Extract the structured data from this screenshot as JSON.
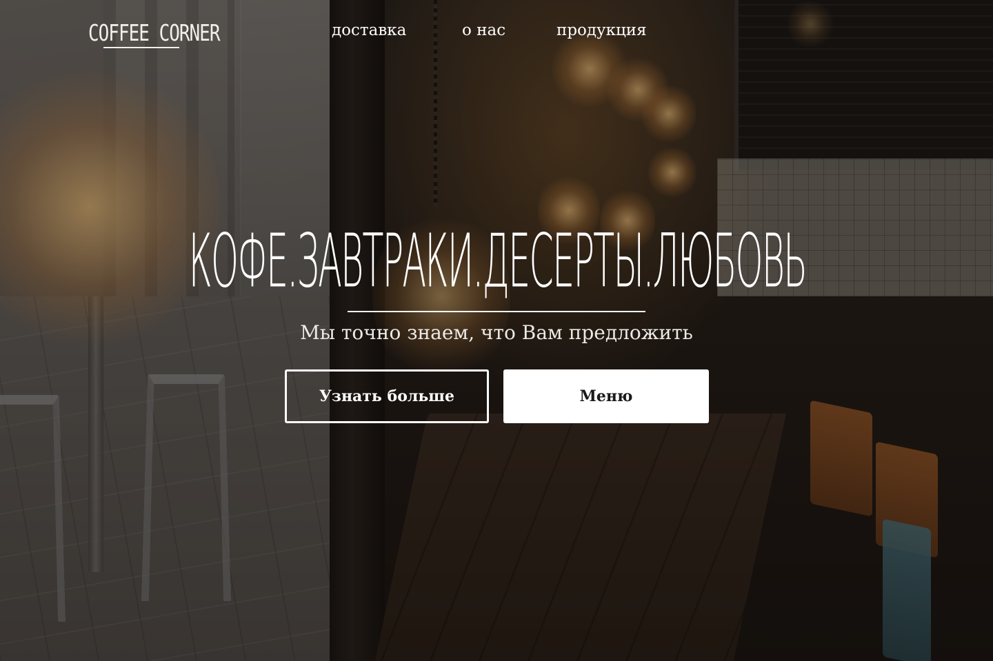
{
  "header": {
    "logo": "COFFEE CORNER",
    "nav": [
      {
        "label": "доставка"
      },
      {
        "label": "о нас"
      },
      {
        "label": "продукция"
      }
    ]
  },
  "hero": {
    "title": "КОФЕ.ЗАВТРАКИ.ДЕСЕРТЫ.ЛЮБОВЬ",
    "subtitle": "Мы точно знаем, что Вам предложить",
    "buttons": {
      "learn_more": "Узнать больше",
      "menu": "Меню"
    }
  },
  "colors": {
    "text": "#ffffff",
    "button_solid_bg": "#ffffff",
    "button_solid_text": "#1a1a1a",
    "overlay": "#0a0806"
  }
}
